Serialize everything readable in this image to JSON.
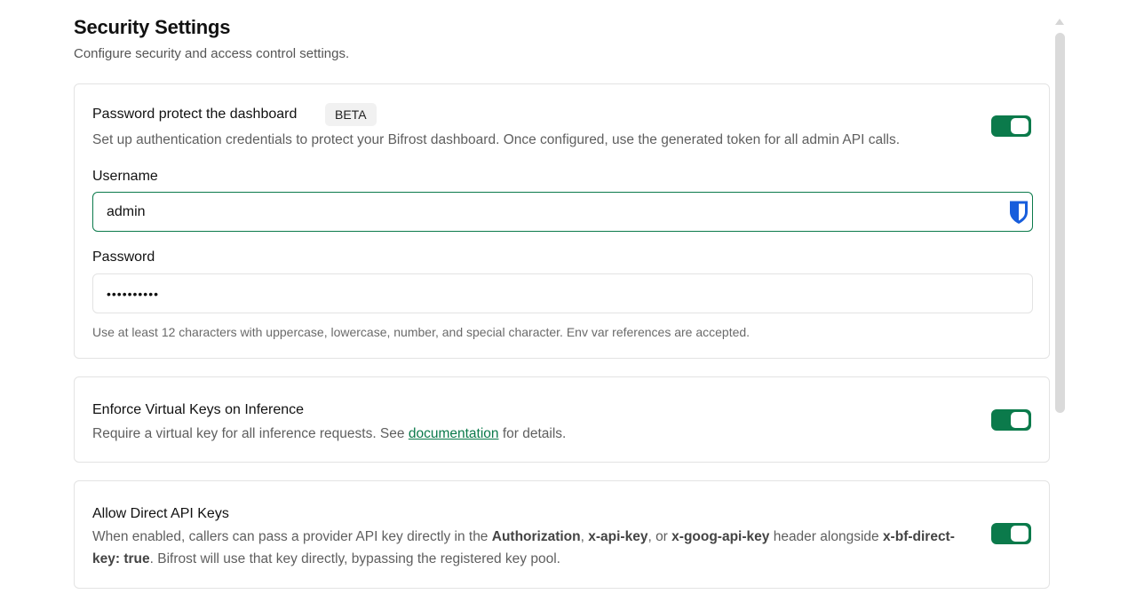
{
  "header": {
    "title": "Security Settings",
    "subtitle": "Configure security and access control settings."
  },
  "password_protect": {
    "title": "Password protect the dashboard",
    "badge": "BETA",
    "description": "Set up authentication credentials to protect your Bifrost dashboard. Once configured, use the generated token for all admin API calls.",
    "enabled": true,
    "username_label": "Username",
    "username_value": "admin",
    "password_label": "Password",
    "password_value": "••••••••••",
    "password_hint": "Use at least 12 characters with uppercase, lowercase, number, and special character. Env var references are accepted."
  },
  "enforce_virtual_keys": {
    "title": "Enforce Virtual Keys on Inference",
    "description_prefix": "Require a virtual key for all inference requests. See ",
    "link_text": "documentation",
    "description_suffix": " for details.",
    "enabled": true
  },
  "direct_api_keys": {
    "title": "Allow Direct API Keys",
    "desc_part1": "When enabled, callers can pass a provider API key directly in the ",
    "header_authorization": "Authorization",
    "desc_sep1": ", ",
    "header_x_api_key": "x-api-key",
    "desc_sep2": ", or ",
    "header_x_goog_api_key": "x-goog-api-key",
    "desc_part2": " header alongside ",
    "header_direct_key": "x-bf-direct-key: true",
    "desc_part3": ". Bifrost will use that key directly, bypassing the registered key pool.",
    "enabled": true
  },
  "icons": {
    "password_manager": "bitwarden-shield-icon"
  },
  "colors": {
    "accent": "#0b7a4b",
    "toggle_knob": "#ffffff",
    "bitwarden": "#175ddc"
  }
}
